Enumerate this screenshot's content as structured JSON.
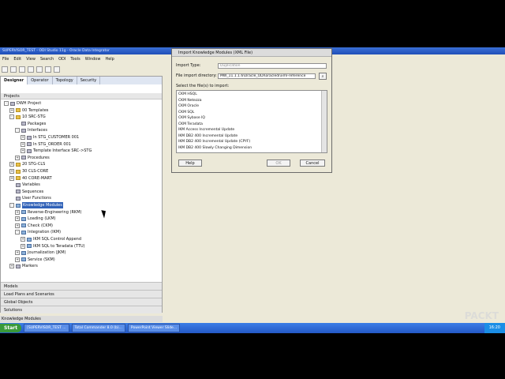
{
  "window": {
    "title": "SUPERVISOR_TEST - ODI Studio 11g - Oracle Data Integrator"
  },
  "menu": [
    "File",
    "Edit",
    "View",
    "Search",
    "ODI",
    "Tools",
    "Window",
    "Help"
  ],
  "tabs": [
    "Designer",
    "Operator",
    "Topology",
    "Security"
  ],
  "projects_header": "Projects",
  "tree": [
    {
      "label": "DWH Project",
      "indent": 0,
      "icon": "gen",
      "exp": "-"
    },
    {
      "label": "00 Templates",
      "indent": 1,
      "icon": "folder",
      "exp": "+"
    },
    {
      "label": "10 SRC-STG",
      "indent": 1,
      "icon": "folder",
      "exp": "-"
    },
    {
      "label": "Packages",
      "indent": 2,
      "icon": "gen",
      "exp": ""
    },
    {
      "label": "Interfaces",
      "indent": 2,
      "icon": "gen",
      "exp": "-"
    },
    {
      "label": "In STG_CUSTOMER 001",
      "indent": 3,
      "icon": "gen",
      "exp": "+"
    },
    {
      "label": "In STG_ORDER 001",
      "indent": 3,
      "icon": "gen",
      "exp": "+"
    },
    {
      "label": "Template Interface SRC->STG",
      "indent": 3,
      "icon": "gen",
      "exp": "+"
    },
    {
      "label": "Procedures",
      "indent": 2,
      "icon": "gen",
      "exp": "+"
    },
    {
      "label": "20 STG-CLS",
      "indent": 1,
      "icon": "folder",
      "exp": "+"
    },
    {
      "label": "30 CLS-CORE",
      "indent": 1,
      "icon": "folder",
      "exp": "+"
    },
    {
      "label": "40 CORE-MART",
      "indent": 1,
      "icon": "folder",
      "exp": "+"
    },
    {
      "label": "Variables",
      "indent": 1,
      "icon": "gen",
      "exp": ""
    },
    {
      "label": "Sequences",
      "indent": 1,
      "icon": "gen",
      "exp": ""
    },
    {
      "label": "User Functions",
      "indent": 1,
      "icon": "gen",
      "exp": ""
    },
    {
      "label": "Knowledge Modules",
      "indent": 1,
      "icon": "km",
      "exp": "-",
      "selected": true
    },
    {
      "label": "Reverse-Engineering (RKM)",
      "indent": 2,
      "icon": "km",
      "exp": "+"
    },
    {
      "label": "Loading (LKM)",
      "indent": 2,
      "icon": "km",
      "exp": "+"
    },
    {
      "label": "Check (CKM)",
      "indent": 2,
      "icon": "km",
      "exp": "+"
    },
    {
      "label": "Integration (IKM)",
      "indent": 2,
      "icon": "km",
      "exp": "-"
    },
    {
      "label": "IKM SQL Control Append",
      "indent": 3,
      "icon": "km",
      "exp": "+"
    },
    {
      "label": "IKM SQL to Teradata (TTU)",
      "indent": 3,
      "icon": "km",
      "exp": "+"
    },
    {
      "label": "Journalization (JKM)",
      "indent": 2,
      "icon": "km",
      "exp": "+"
    },
    {
      "label": "Service (SKM)",
      "indent": 2,
      "icon": "km",
      "exp": "+"
    },
    {
      "label": "Markers",
      "indent": 1,
      "icon": "gen",
      "exp": "+"
    }
  ],
  "accordions": [
    "Models",
    "Load Plans and Scenarios",
    "Global Objects",
    "Solutions"
  ],
  "status_text": "Knowledge Modules",
  "dialog": {
    "title": "Import Knowledge Modules (XML File)",
    "import_type_label": "Import Type:",
    "import_type_value": "Duplication",
    "dir_label": "File import directory:",
    "dir_value": "MW_11.1.1.6\\Oracle_ODI\\oracledi\\xml-reference",
    "select_label": "Select the file(s) to import:",
    "files": [
      "CKM HSQL",
      "CKM Netezza",
      "CKM Oracle",
      "CKM SQL",
      "CKM Sybase IQ",
      "CKM Teradata",
      "IKM Access Incremental Update",
      "IKM DB2 400 Incremental Update",
      "IKM DB2 400 Incremental Update (CPYF)",
      "IKM DB2 400 Slowly Changing Dimension"
    ],
    "help": "Help",
    "ok": "OK",
    "cancel": "Cancel"
  },
  "taskbar": {
    "start": "Start",
    "tasks": [
      "[SUPERVISOR_TEST ...",
      "Total Commander 8.0 (b)...",
      "PowerPoint Viewer Slide..."
    ],
    "clock": "16:20"
  },
  "watermark": "PACKT"
}
